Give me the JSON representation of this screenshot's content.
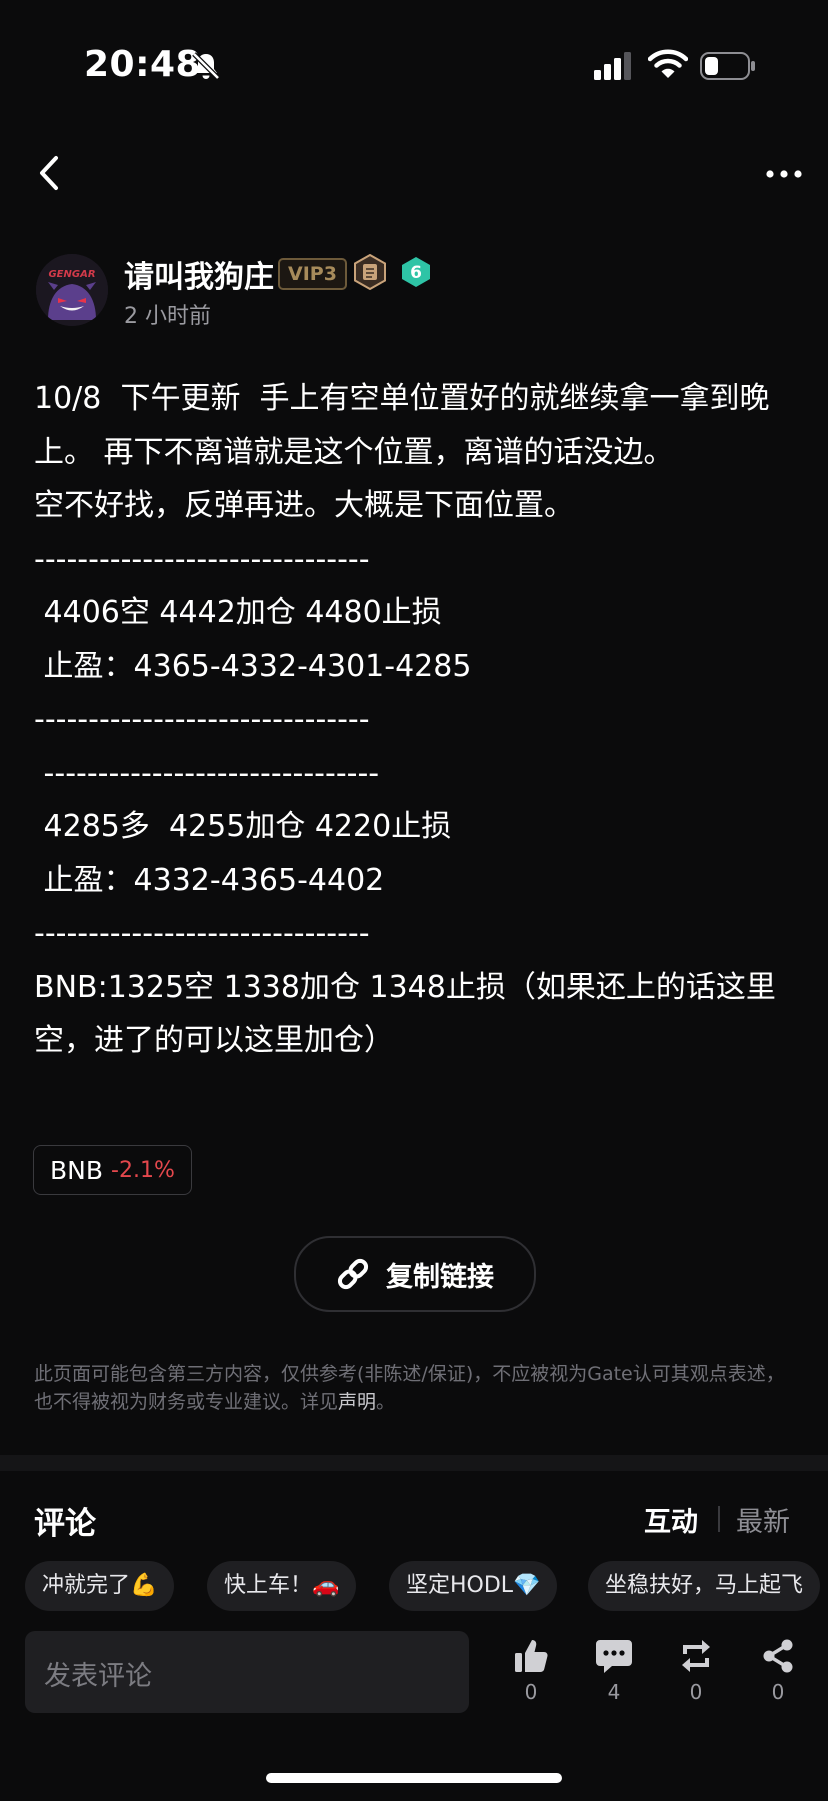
{
  "status_bar": {
    "time": "20:48"
  },
  "author": {
    "name": "请叫我狗庄",
    "vip_badge": "VIP3",
    "level": "6",
    "avatar_text": "GENGAR",
    "posted": "2 小时前"
  },
  "post": {
    "body": "10/8  下午更新  手上有空单位置好的就继续拿一拿到晚上。 再下不离谱就是这个位置，离谱的话没边。\n空不好找，反弹再进。大概是下面位置。\n-------------------------------\n 4406空 4442加仓 4480止损\n 止盈：4365-4332-4301-4285\n-------------------------------\n -------------------------------\n 4285多  4255加仓 4220止损\n 止盈：4332-4365-4402\n-------------------------------\nBNB:1325空 1338加仓 1348止损（如果还上的话这里空，进了的可以这里加仓）",
    "token": {
      "symbol": "BNB",
      "change": "-2.1%"
    },
    "copy_link_label": "复制链接",
    "disclaimer_text": "此页面可能包含第三方内容，仅供参考(非陈述/保证)，不应被视为Gate认可其观点表述，也不得被视为财务或专业建议。详见",
    "disclaimer_link": "声明",
    "disclaimer_end": "。"
  },
  "comments": {
    "title": "评论",
    "tab_interact": "互动",
    "tab_latest": "最新",
    "quick_replies": [
      "冲就完了💪",
      "快上车！🚗",
      "坚定HODL💎",
      "坐稳扶好，马上起飞"
    ],
    "input_placeholder": "发表评论"
  },
  "actions": {
    "likes": "0",
    "comments": "4",
    "reposts": "0",
    "shares": "0"
  },
  "colors": {
    "background": "#0b0b0c",
    "negative": "#e5484d",
    "vip_gold": "#a78b5b",
    "level_teal": "#2ec4a6"
  }
}
